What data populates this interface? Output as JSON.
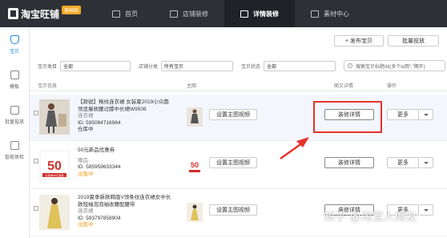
{
  "app": {
    "logo_text": "淘宝旺铺",
    "badge": "基础版"
  },
  "nav": {
    "items": [
      {
        "label": "首页",
        "icon": "home-icon"
      },
      {
        "label": "店铺装修",
        "icon": "store-icon"
      },
      {
        "label": "详情装修",
        "icon": "detail-icon",
        "active": true
      },
      {
        "label": "素材中心",
        "icon": "folder-icon"
      }
    ]
  },
  "sidebar": {
    "items": [
      {
        "label": "宝贝",
        "icon": "item-icon",
        "active": true
      },
      {
        "label": "模板",
        "icon": "template-icon"
      },
      {
        "label": "批量投放",
        "icon": "bulk-icon"
      },
      {
        "label": "智能体检",
        "icon": "shield-icon"
      }
    ]
  },
  "toolbar": {
    "publish_label": "+ 发布宝贝",
    "bulk_label": "批量投放"
  },
  "filters": {
    "category_label": "宝贝类目",
    "category_value": "全部",
    "store_cat_label": "店铺分类",
    "store_cat_value": "所有宝贝",
    "status_label": "宝贝状态",
    "status_value": "全部",
    "search_placeholder": "搜索宝贝标题/id(多个id用“,”隔开)"
  },
  "table": {
    "headers": {
      "info": "宝贝信息",
      "main_image": "主图",
      "detail": "图文详情",
      "action": "操作"
    },
    "rows": [
      {
        "title": "【款锐】格纹连衣裙 女装夏2019小众圆领显瘦收腰过膝中长裙W9508",
        "category": "连衣裙",
        "id": "ID: 595084716984",
        "status": "仓库中"
      },
      {
        "title": "50元新品优惠券",
        "category": "赠品",
        "id": "ID: 585959633344",
        "status": "出售中"
      },
      {
        "title": "2019夏季新款韩版V领条纹连衣裙女中长款短袖泡泡袖收腰配腰带",
        "category": "连衣裙",
        "id": "ID: 593797858904",
        "status": "出售中"
      }
    ],
    "set_video_label": "设置主图视频",
    "edit_detail_label": "装修详情",
    "more_label": "更多"
  },
  "coupon": {
    "value": "50",
    "caption": "全场满580元使用"
  },
  "watermark": "知乎 @淘宝人傅友",
  "colors": {
    "topbar": "#2d3136",
    "accent": "#1e8ae8",
    "highlight": "#e5322d",
    "status": "#f39c12"
  }
}
